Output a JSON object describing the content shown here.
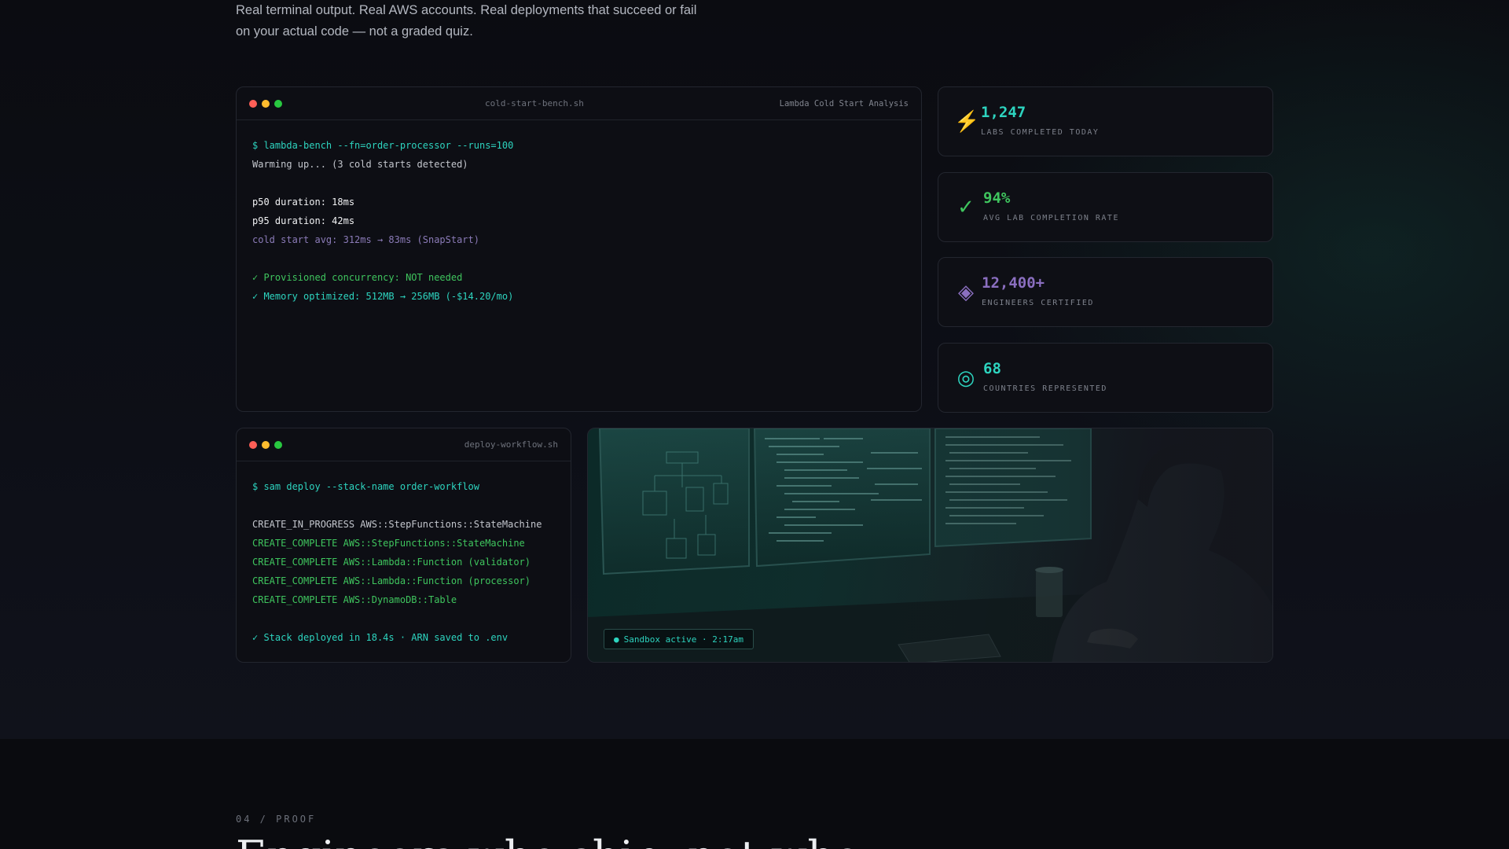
{
  "intro": {
    "line1": "Real terminal output. Real AWS accounts. Real deployments that succeed or fail",
    "line2": "on your actual code — not a graded quiz."
  },
  "terminal_cold": {
    "filename": "cold-start-bench.sh",
    "tag": "Lambda Cold Start Analysis",
    "lines": [
      "$ lambda-bench --fn=order-processor --runs=100",
      "Warming up... (3 cold starts detected)",
      "",
      "p50 duration: 18ms",
      "p95 duration: 42ms",
      "cold start avg: 312ms → 83ms (SnapStart)",
      "",
      "✓ Provisioned concurrency: NOT needed",
      "✓ Memory optimized: 512MB → 256MB (-$14.20/mo)"
    ]
  },
  "terminal_deploy": {
    "filename": "deploy-workflow.sh",
    "lines": [
      "$ sam deploy --stack-name order-workflow",
      "",
      "CREATE_IN_PROGRESS AWS::StepFunctions::StateMachine",
      "CREATE_COMPLETE AWS::StepFunctions::StateMachine",
      "CREATE_COMPLETE AWS::Lambda::Function (validator)",
      "CREATE_COMPLETE AWS::Lambda::Function (processor)",
      "CREATE_COMPLETE AWS::DynamoDB::Table",
      "",
      "✓ Stack deployed in 18.4s · ARN saved to .env"
    ]
  },
  "stats": [
    {
      "icon": "lightning-icon",
      "glyph": "⚡",
      "value": "1,247",
      "label": "LABS COMPLETED TODAY",
      "color": "#2dd4bf"
    },
    {
      "icon": "check-icon",
      "glyph": "✓",
      "value": "94%",
      "label": "AVG LAB COMPLETION RATE",
      "color": "#3fc55e"
    },
    {
      "icon": "diamond-icon",
      "glyph": "◈",
      "value": "12,400+",
      "label": "ENGINEERS CERTIFIED",
      "color": "#8b6fc0"
    },
    {
      "icon": "target-icon",
      "glyph": "◎",
      "value": "68",
      "label": "COUNTRIES REPRESENTED",
      "color": "#2dd4bf"
    }
  ],
  "photo": {
    "badge_dot": "●",
    "badge_text": "Sandbox active · 2:17am"
  },
  "proof": {
    "label": "04 / PROOF",
    "heading": "Engineers who ship, not who"
  },
  "colors": {
    "accent_teal": "#2dd4bf",
    "success_green": "#3fc55e",
    "purple": "#8b6fc0",
    "background": "#0b0c11"
  }
}
